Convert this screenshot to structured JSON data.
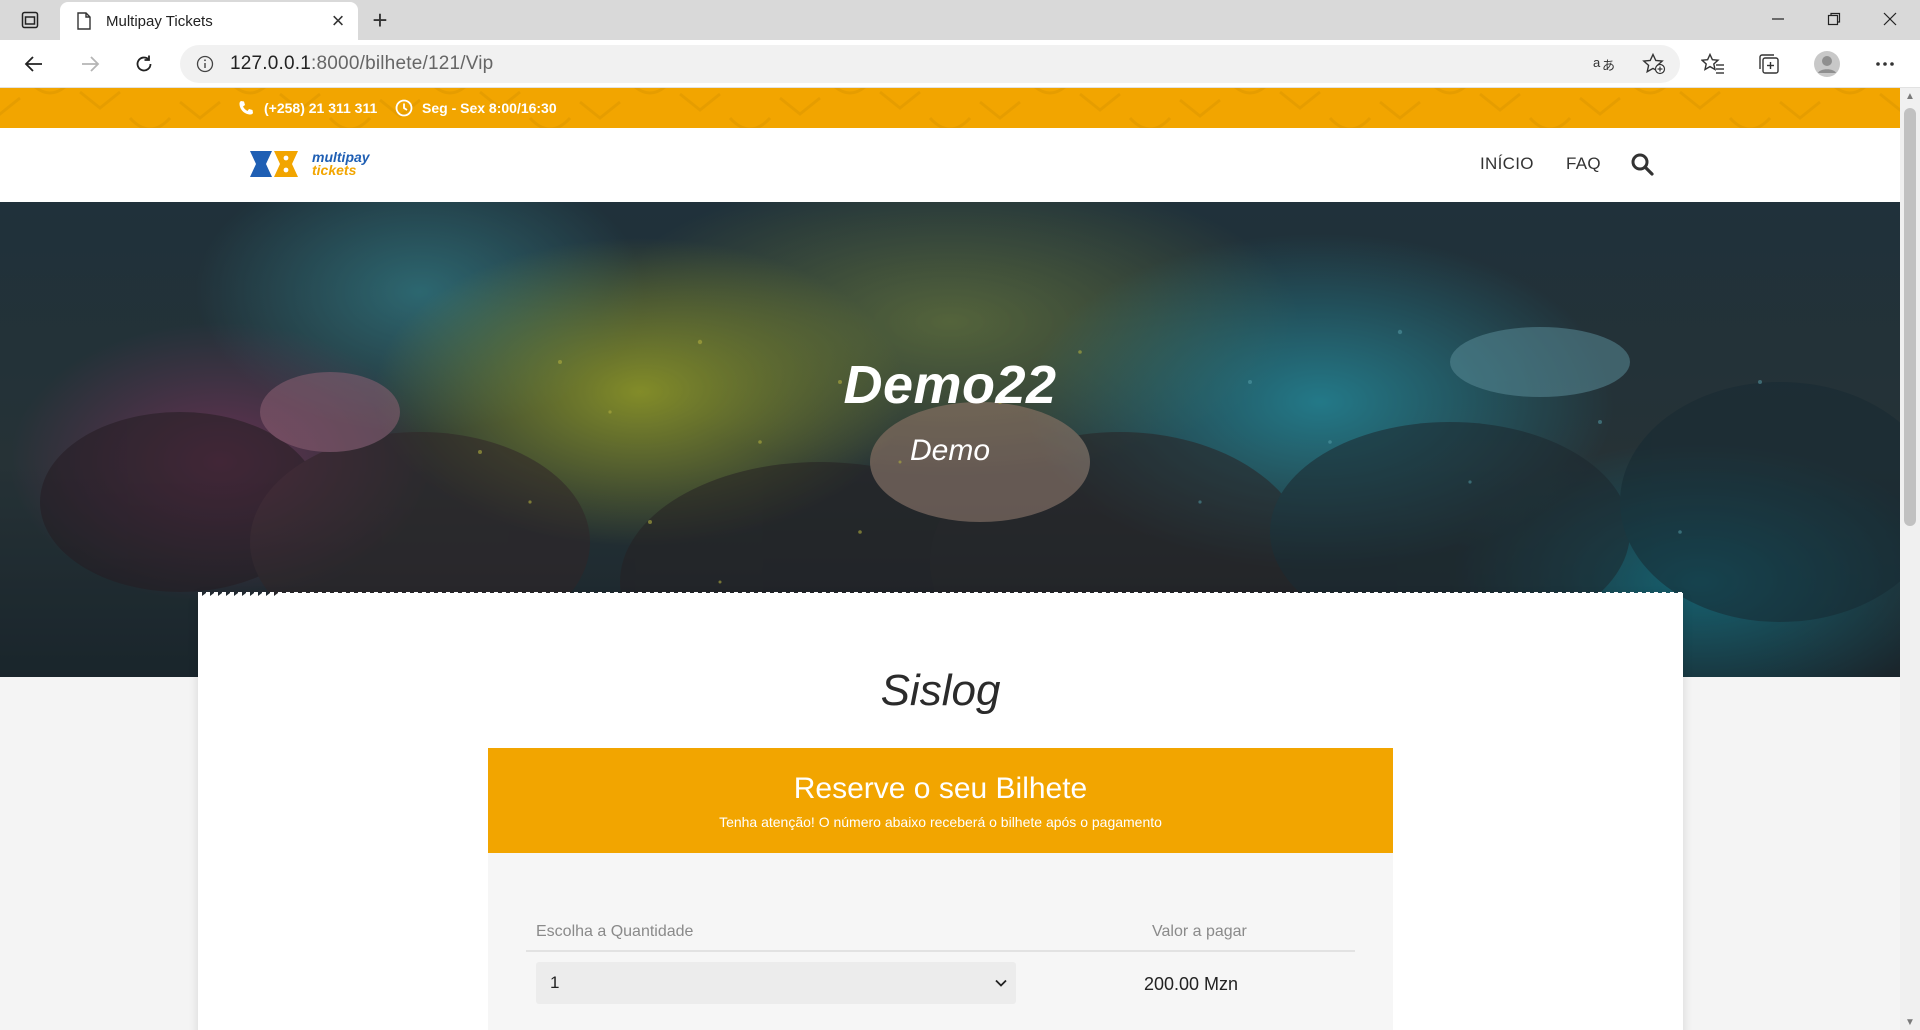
{
  "browser": {
    "tab_title": "Multipay Tickets",
    "url_host": "127.0.0.1",
    "url_path": ":8000/bilhete/121/Vip",
    "icons": [
      "tab-actions-icon",
      "document-icon",
      "close-icon",
      "plus-icon",
      "minimize-icon",
      "restore-icon",
      "close-window-icon",
      "back-icon",
      "forward-icon",
      "refresh-icon",
      "info-icon",
      "read-aloud-icon",
      "add-favorite-icon",
      "favorites-icon",
      "collections-icon",
      "profile-icon",
      "more-icon"
    ]
  },
  "topbar": {
    "phone": "(+258) 21 311 311",
    "hours": "Seg - Sex 8:00/16:30"
  },
  "logo": {
    "line1": "multipay",
    "line2": "tickets"
  },
  "nav": {
    "items": [
      {
        "label": "INÍCIO"
      },
      {
        "label": "FAQ"
      }
    ]
  },
  "hero": {
    "title": "Demo22",
    "subtitle": "Demo"
  },
  "card": {
    "title": "Sislog",
    "reserve": {
      "title": "Reserve o seu Bilhete",
      "subtitle": "Tenha atenção! O número abaixo receberá o bilhete após o pagamento"
    },
    "form": {
      "quantity_label": "Escolha a Quantidade",
      "amount_label": "Valor a pagar",
      "quantity_value": "1",
      "amount_value": "200.00 Mzn"
    }
  },
  "colors": {
    "brand_orange": "#f2a500",
    "brand_blue": "#1f5fb4"
  }
}
